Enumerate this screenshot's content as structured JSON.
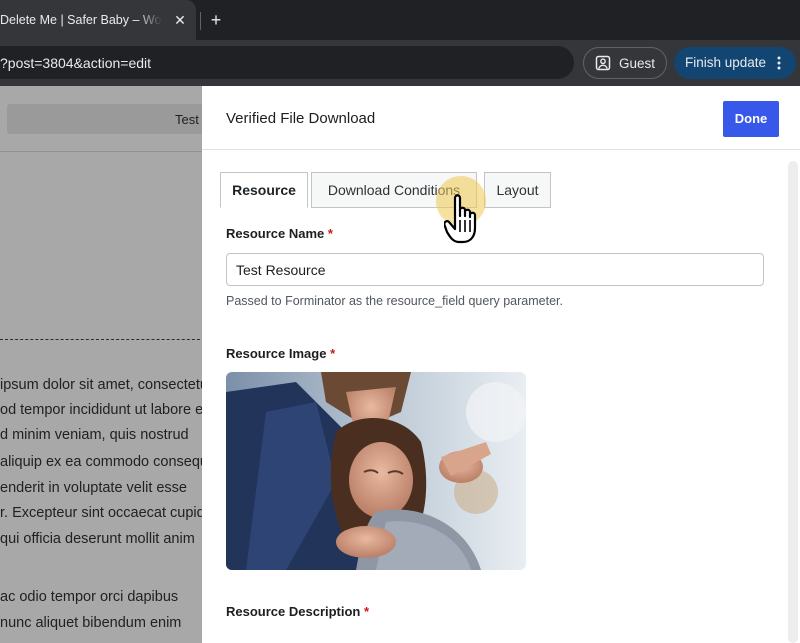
{
  "browser": {
    "tab_title": "Delete Me | Safer Baby – WordPress",
    "tab_close_glyph": "✕",
    "new_tab_glyph": "+",
    "url": "?post=3804&action=edit",
    "guest_label": "Guest",
    "finish_update_label": "Finish update"
  },
  "page": {
    "title_bar_text": "Test ·",
    "paragraph_lines": [
      "ipsum dolor sit amet, consectetur",
      "od tempor incididunt ut labore et",
      "d minim veniam, quis nostrud",
      "aliquip ex ea commodo consequat.",
      "enderit in voluptate velit esse",
      "r. Excepteur sint occaecat cupidatat",
      "qui officia deserunt mollit anim",
      "",
      "ac odio tempor orci dapibus",
      "nunc aliquet bibendum enim"
    ]
  },
  "panel": {
    "title": "Verified File Download",
    "done_label": "Done",
    "tabs": [
      {
        "label": "Resource",
        "active": true
      },
      {
        "label": "Download Conditions",
        "active": false
      },
      {
        "label": "Layout",
        "active": false
      }
    ],
    "resource_name": {
      "label": "Resource Name",
      "required_mark": "*",
      "value": "Test Resource",
      "help": "Passed to Forminator as the resource_field query parameter."
    },
    "resource_image": {
      "label": "Resource Image",
      "required_mark": "*"
    },
    "resource_description": {
      "label": "Resource Description",
      "required_mark": "*"
    }
  },
  "colors": {
    "accent": "#3858e9",
    "required": "#cc1818",
    "finish_update_bg": "#124572"
  }
}
